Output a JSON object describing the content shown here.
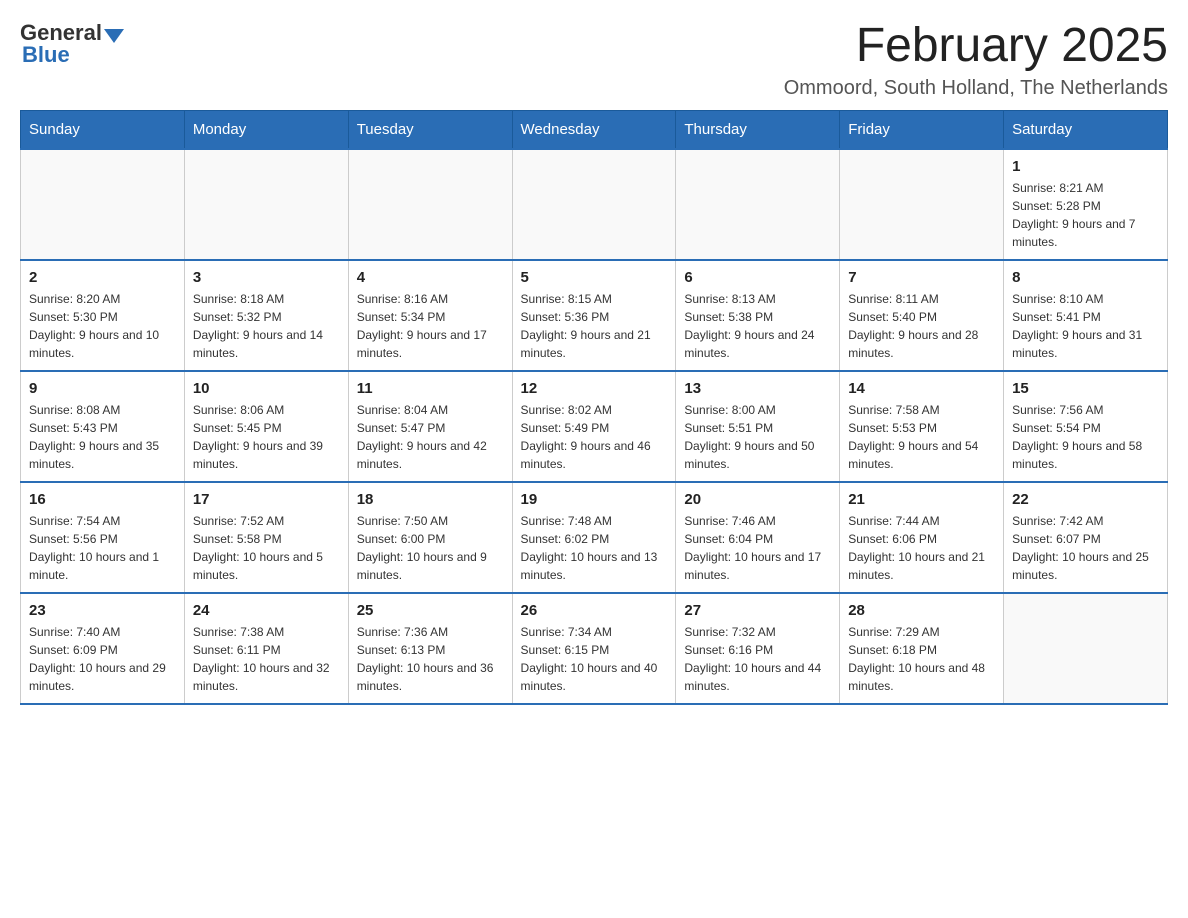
{
  "logo": {
    "general": "General",
    "blue": "Blue"
  },
  "title": "February 2025",
  "location": "Ommoord, South Holland, The Netherlands",
  "days_of_week": [
    "Sunday",
    "Monday",
    "Tuesday",
    "Wednesday",
    "Thursday",
    "Friday",
    "Saturday"
  ],
  "weeks": [
    [
      {
        "day": "",
        "info": ""
      },
      {
        "day": "",
        "info": ""
      },
      {
        "day": "",
        "info": ""
      },
      {
        "day": "",
        "info": ""
      },
      {
        "day": "",
        "info": ""
      },
      {
        "day": "",
        "info": ""
      },
      {
        "day": "1",
        "info": "Sunrise: 8:21 AM\nSunset: 5:28 PM\nDaylight: 9 hours and 7 minutes."
      }
    ],
    [
      {
        "day": "2",
        "info": "Sunrise: 8:20 AM\nSunset: 5:30 PM\nDaylight: 9 hours and 10 minutes."
      },
      {
        "day": "3",
        "info": "Sunrise: 8:18 AM\nSunset: 5:32 PM\nDaylight: 9 hours and 14 minutes."
      },
      {
        "day": "4",
        "info": "Sunrise: 8:16 AM\nSunset: 5:34 PM\nDaylight: 9 hours and 17 minutes."
      },
      {
        "day": "5",
        "info": "Sunrise: 8:15 AM\nSunset: 5:36 PM\nDaylight: 9 hours and 21 minutes."
      },
      {
        "day": "6",
        "info": "Sunrise: 8:13 AM\nSunset: 5:38 PM\nDaylight: 9 hours and 24 minutes."
      },
      {
        "day": "7",
        "info": "Sunrise: 8:11 AM\nSunset: 5:40 PM\nDaylight: 9 hours and 28 minutes."
      },
      {
        "day": "8",
        "info": "Sunrise: 8:10 AM\nSunset: 5:41 PM\nDaylight: 9 hours and 31 minutes."
      }
    ],
    [
      {
        "day": "9",
        "info": "Sunrise: 8:08 AM\nSunset: 5:43 PM\nDaylight: 9 hours and 35 minutes."
      },
      {
        "day": "10",
        "info": "Sunrise: 8:06 AM\nSunset: 5:45 PM\nDaylight: 9 hours and 39 minutes."
      },
      {
        "day": "11",
        "info": "Sunrise: 8:04 AM\nSunset: 5:47 PM\nDaylight: 9 hours and 42 minutes."
      },
      {
        "day": "12",
        "info": "Sunrise: 8:02 AM\nSunset: 5:49 PM\nDaylight: 9 hours and 46 minutes."
      },
      {
        "day": "13",
        "info": "Sunrise: 8:00 AM\nSunset: 5:51 PM\nDaylight: 9 hours and 50 minutes."
      },
      {
        "day": "14",
        "info": "Sunrise: 7:58 AM\nSunset: 5:53 PM\nDaylight: 9 hours and 54 minutes."
      },
      {
        "day": "15",
        "info": "Sunrise: 7:56 AM\nSunset: 5:54 PM\nDaylight: 9 hours and 58 minutes."
      }
    ],
    [
      {
        "day": "16",
        "info": "Sunrise: 7:54 AM\nSunset: 5:56 PM\nDaylight: 10 hours and 1 minute."
      },
      {
        "day": "17",
        "info": "Sunrise: 7:52 AM\nSunset: 5:58 PM\nDaylight: 10 hours and 5 minutes."
      },
      {
        "day": "18",
        "info": "Sunrise: 7:50 AM\nSunset: 6:00 PM\nDaylight: 10 hours and 9 minutes."
      },
      {
        "day": "19",
        "info": "Sunrise: 7:48 AM\nSunset: 6:02 PM\nDaylight: 10 hours and 13 minutes."
      },
      {
        "day": "20",
        "info": "Sunrise: 7:46 AM\nSunset: 6:04 PM\nDaylight: 10 hours and 17 minutes."
      },
      {
        "day": "21",
        "info": "Sunrise: 7:44 AM\nSunset: 6:06 PM\nDaylight: 10 hours and 21 minutes."
      },
      {
        "day": "22",
        "info": "Sunrise: 7:42 AM\nSunset: 6:07 PM\nDaylight: 10 hours and 25 minutes."
      }
    ],
    [
      {
        "day": "23",
        "info": "Sunrise: 7:40 AM\nSunset: 6:09 PM\nDaylight: 10 hours and 29 minutes."
      },
      {
        "day": "24",
        "info": "Sunrise: 7:38 AM\nSunset: 6:11 PM\nDaylight: 10 hours and 32 minutes."
      },
      {
        "day": "25",
        "info": "Sunrise: 7:36 AM\nSunset: 6:13 PM\nDaylight: 10 hours and 36 minutes."
      },
      {
        "day": "26",
        "info": "Sunrise: 7:34 AM\nSunset: 6:15 PM\nDaylight: 10 hours and 40 minutes."
      },
      {
        "day": "27",
        "info": "Sunrise: 7:32 AM\nSunset: 6:16 PM\nDaylight: 10 hours and 44 minutes."
      },
      {
        "day": "28",
        "info": "Sunrise: 7:29 AM\nSunset: 6:18 PM\nDaylight: 10 hours and 48 minutes."
      },
      {
        "day": "",
        "info": ""
      }
    ]
  ]
}
